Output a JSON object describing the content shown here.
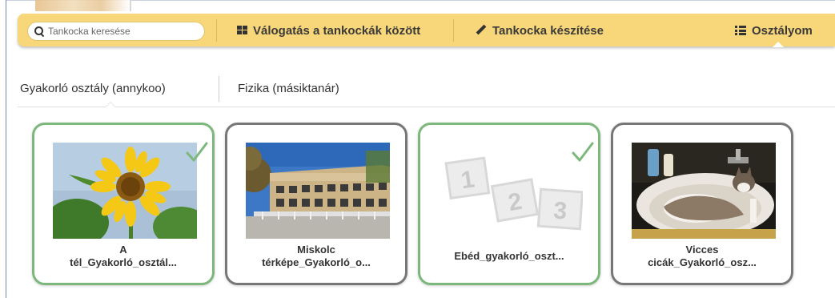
{
  "navbar": {
    "search_placeholder": "Tankocka keresése",
    "items": [
      {
        "label": "Válogatás a tankockák között",
        "icon": "grid-icon"
      },
      {
        "label": "Tankocka készítése",
        "icon": "pencil-icon"
      },
      {
        "label": "Osztályom",
        "icon": "list-icon",
        "active": true
      }
    ]
  },
  "classes": {
    "tabs": [
      {
        "label": "Gyakorló osztály (annykoo)",
        "active": true
      },
      {
        "label": "Fizika (másiktanár)",
        "active": false
      }
    ]
  },
  "cards": [
    {
      "title_line1": "A",
      "title_line2": "tél_Gyakorló_osztál...",
      "thumbnail": "sunflower-thumbnail",
      "completed": true
    },
    {
      "title_line1": "Miskolc",
      "title_line2": "térképe_Gyakorló_o...",
      "thumbnail": "school-building-thumbnail",
      "completed": false
    },
    {
      "title_line1": "Ebéd_gyakorló_oszt...",
      "title_line2": "",
      "thumbnail": "numbered-cards-placeholder-thumbnail",
      "completed": true
    },
    {
      "title_line1": "Vicces",
      "title_line2": "cicák_Gyakorló_osz...",
      "thumbnail": "cat-in-sink-thumbnail",
      "completed": false
    }
  ],
  "colors": {
    "navbar_bg": "#f8d77a",
    "completed_border": "#7cb87c",
    "pending_border": "#777777",
    "check": "#7cb87c"
  }
}
